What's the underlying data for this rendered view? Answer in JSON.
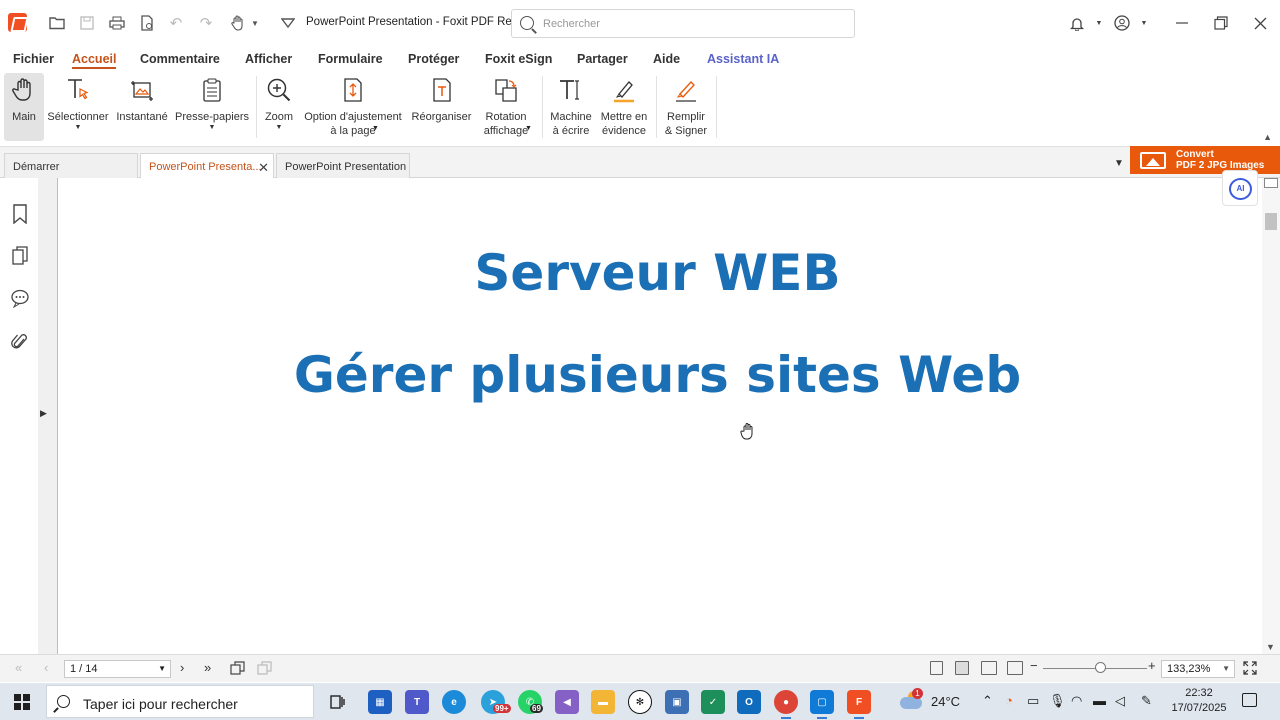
{
  "window": {
    "title": "PowerPoint Presentation - Foxit PDF Rea...",
    "search_placeholder": "Rechercher"
  },
  "menu": {
    "items": [
      "Fichier",
      "Accueil",
      "Commentaire",
      "Afficher",
      "Formulaire",
      "Protéger",
      "Foxit eSign",
      "Partager",
      "Aide",
      "Assistant IA"
    ],
    "active": "Accueil"
  },
  "ribbon": {
    "main": "Main",
    "select": "Sélectionner",
    "snapshot": "Instantané",
    "clipboard": "Presse-papiers",
    "zoom": "Zoom",
    "fit_line1": "Option d'ajustement",
    "fit_line2": "à la page",
    "reorganize": "Réorganiser",
    "rotate_line1": "Rotation",
    "rotate_line2": "affichage",
    "typewriter_line1": "Machine",
    "typewriter_line2": "à écrire",
    "highlight_line1": "Mettre en",
    "highlight_line2": "évidence",
    "fillsign_line1": "Remplir",
    "fillsign_line2": "& Signer"
  },
  "tabs": [
    {
      "label": "Démarrer",
      "active": false
    },
    {
      "label": "PowerPoint Presenta...",
      "active": true
    },
    {
      "label": "PowerPoint Presentation",
      "active": false
    }
  ],
  "banner": {
    "line1": "Convert",
    "line2": "PDF 2 JPG Images"
  },
  "document": {
    "title1": "Serveur WEB",
    "title2": "Gérer plusieurs sites Web"
  },
  "ai_button": "AI",
  "status": {
    "page": "1 / 14",
    "zoom": "133,23%",
    "zoom_fraction": 0.55
  },
  "taskbar": {
    "search_text": "Taper ici pour rechercher",
    "temperature": "24°C",
    "weather_alert": "1",
    "time": "22:32",
    "date": "17/07/2025",
    "badges": {
      "telegram": "99+",
      "whatsapp": "69"
    }
  },
  "colors": {
    "accent": "#c4541b",
    "slide_title": "#1a6fb5",
    "ai_menu": "#5a63c8",
    "banner": "#e8590c"
  }
}
